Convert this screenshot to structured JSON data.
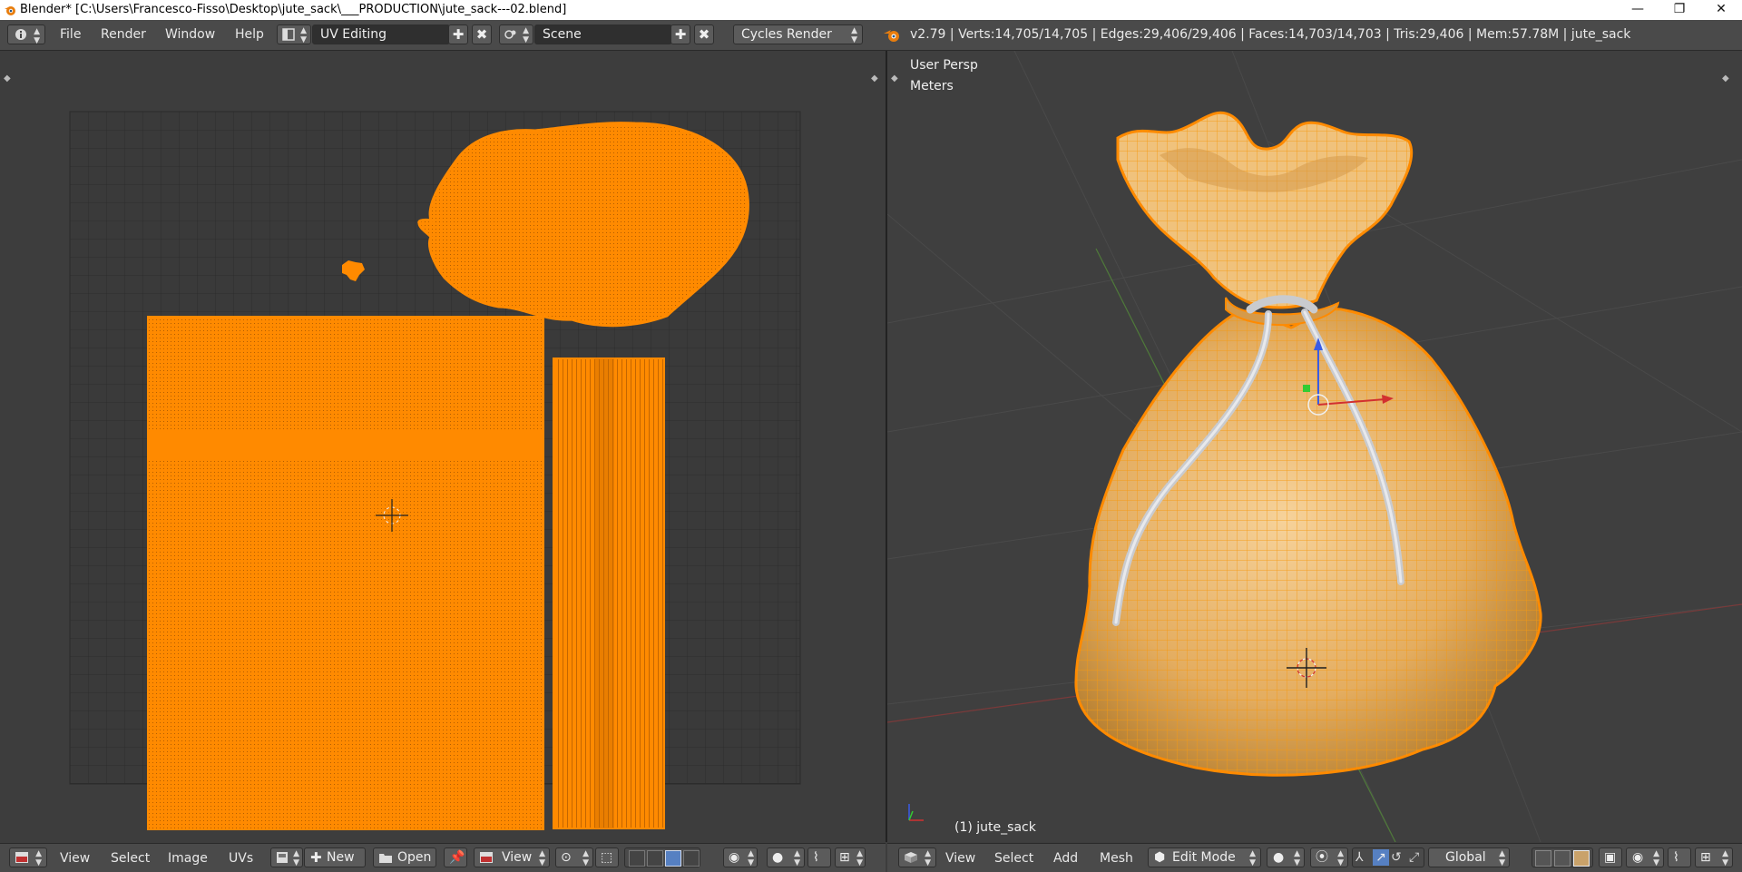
{
  "window": {
    "title": "Blender* [C:\\Users\\Francesco-Fisso\\Desktop\\jute_sack\\___PRODUCTION\\jute_sack---02.blend]",
    "min": "—",
    "max": "❐",
    "close": "✕"
  },
  "menu": {
    "file": "File",
    "render": "Render",
    "window": "Window",
    "help": "Help"
  },
  "screen_layout": {
    "value": "UV Editing"
  },
  "scene": {
    "value": "Scene"
  },
  "render_engine": {
    "value": "Cycles Render"
  },
  "stats": {
    "text": "v2.79 | Verts:14,705/14,705 | Edges:29,406/29,406 | Faces:14,703/14,703 | Tris:29,406 | Mem:57.78M | jute_sack"
  },
  "viewport": {
    "view_name": "User Persp",
    "units": "Meters",
    "object_label": "(1) jute_sack"
  },
  "uv_header": {
    "view": "View",
    "select": "Select",
    "image": "Image",
    "uvs": "UVs",
    "new": "New",
    "open": "Open",
    "view_dd": "View"
  },
  "view3d_header": {
    "view": "View",
    "select": "Select",
    "add": "Add",
    "mesh": "Mesh",
    "mode": "Edit Mode",
    "orientation": "Global"
  },
  "colors": {
    "uv_orange": "#ff8a00",
    "sack_fill": "#e9b770",
    "wire": "#ffa21e",
    "rope": "#c9cbcf",
    "grid_bg": "#3b3b3b",
    "grid_line": "#2e2e2e"
  }
}
